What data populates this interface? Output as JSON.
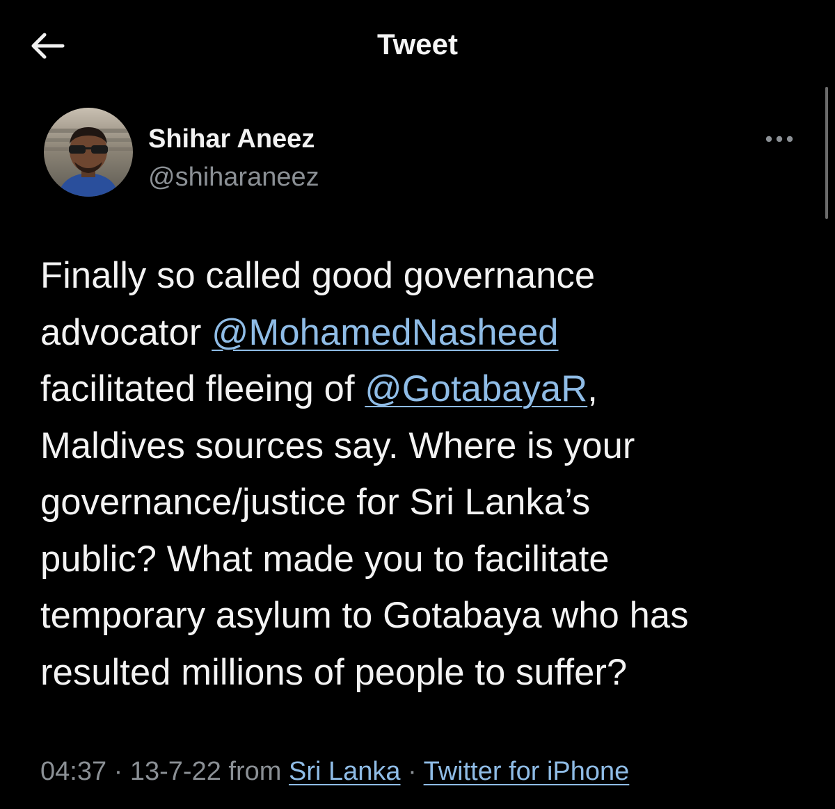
{
  "header": {
    "title": "Tweet",
    "back_icon": "arrow-left-icon"
  },
  "tweet": {
    "author": {
      "name": "Shihar Aneez",
      "handle": "@shiharaneez"
    },
    "more_icon": "more-horizontal-icon",
    "text": {
      "line1": "Finally so called good governance",
      "line2_pre": "advocator ",
      "mention1": "@MohamedNasheed",
      "line3_pre": "facilitated fleeing of ",
      "mention2": "@GotabayaR",
      "line3_post": ",",
      "line4": "Maldives sources say. Where is your",
      "line5": "governance/justice for Sri Lanka’s",
      "line6": "public? What made you to facilitate",
      "line7": "temporary asylum to Gotabaya who has",
      "line8": "resulted millions of people to suffer?"
    },
    "meta": {
      "time": "04:37",
      "separator": "·",
      "date": "13-7-22",
      "from_label": "from",
      "location": "Sri Lanka",
      "client": "Twitter for iPhone"
    }
  },
  "colors": {
    "background": "#000000",
    "text": "#f3f3f3",
    "secondary": "#8b9095",
    "link": "#8fbce6"
  }
}
